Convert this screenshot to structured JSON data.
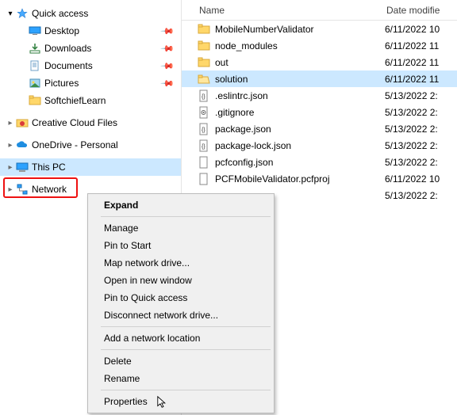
{
  "tree": {
    "quick_access": "Quick access",
    "desktop": "Desktop",
    "downloads": "Downloads",
    "documents": "Documents",
    "pictures": "Pictures",
    "softchief": "SoftchiefLearn",
    "creative_cloud": "Creative Cloud Files",
    "onedrive": "OneDrive - Personal",
    "this_pc": "This PC",
    "network": "Network"
  },
  "header": {
    "name": "Name",
    "date": "Date modifie"
  },
  "files": [
    {
      "icon": "folder",
      "name": "MobileNumberValidator",
      "date": "6/11/2022 10"
    },
    {
      "icon": "folder",
      "name": "node_modules",
      "date": "6/11/2022 11"
    },
    {
      "icon": "folder",
      "name": "out",
      "date": "6/11/2022 11"
    },
    {
      "icon": "folder-open",
      "name": "solution",
      "date": "6/11/2022 11",
      "selected": true
    },
    {
      "icon": "json",
      "name": ".eslintrc.json",
      "date": "5/13/2022 2:"
    },
    {
      "icon": "gear",
      "name": ".gitignore",
      "date": "5/13/2022 2:"
    },
    {
      "icon": "json",
      "name": "package.json",
      "date": "5/13/2022 2:"
    },
    {
      "icon": "json",
      "name": "package-lock.json",
      "date": "5/13/2022 2:"
    },
    {
      "icon": "file",
      "name": "pcfconfig.json",
      "date": "5/13/2022 2:"
    },
    {
      "icon": "file",
      "name": "PCFMobileValidator.pcfproj",
      "date": "6/11/2022 10"
    },
    {
      "icon": "blank",
      "name": "",
      "date": "5/13/2022 2:"
    }
  ],
  "menu": {
    "expand": "Expand",
    "manage": "Manage",
    "pin_start": "Pin to Start",
    "map_drive": "Map network drive...",
    "open_new": "Open in new window",
    "pin_quick": "Pin to Quick access",
    "disconnect": "Disconnect network drive...",
    "add_loc": "Add a network location",
    "delete": "Delete",
    "rename": "Rename",
    "properties": "Properties"
  }
}
